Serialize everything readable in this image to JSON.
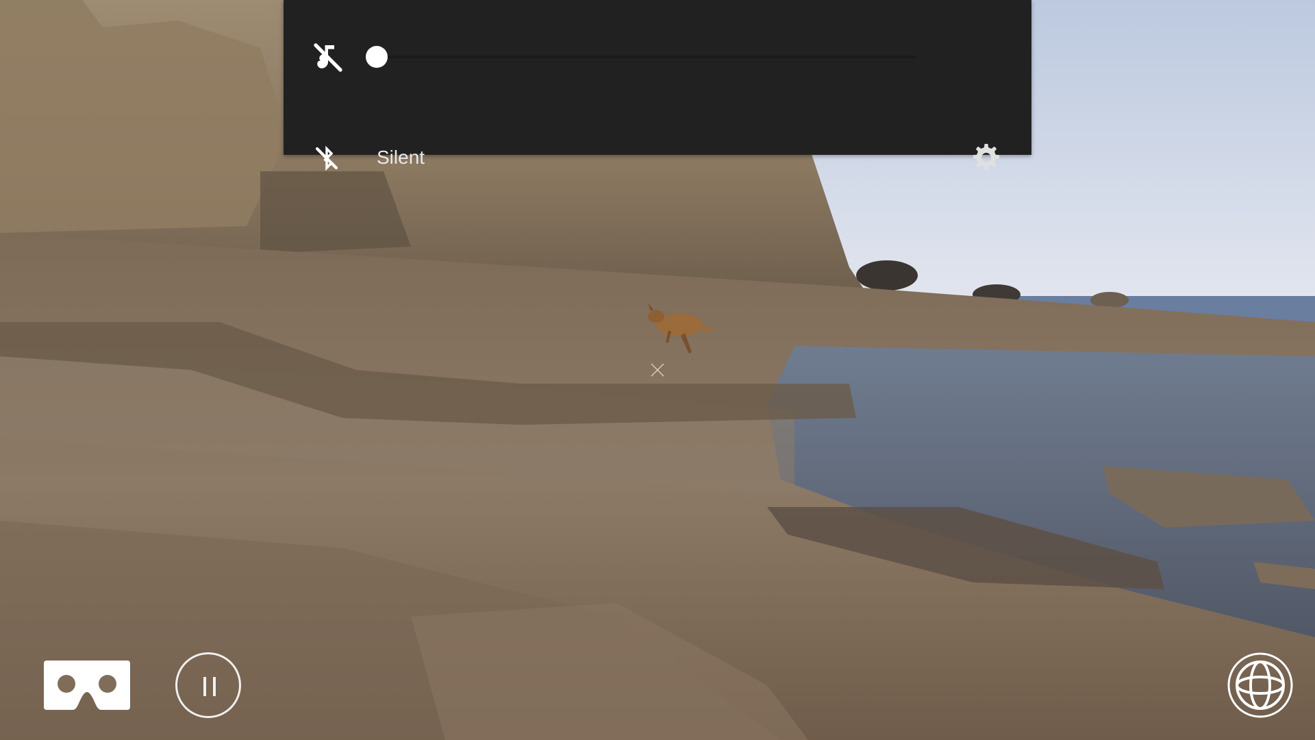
{
  "player": {
    "mode": "360 video",
    "state": "playing"
  },
  "volume_panel": {
    "slider_value": 0,
    "row1_icon": "volume-muted-icon",
    "row2_icon": "bluetooth-off-icon",
    "row2_label": "Silent",
    "row2_right_icon": "gear-icon",
    "colors": {
      "panel_bg": "#212121",
      "thumb": "#ffffff",
      "track": "#1a1a1a"
    }
  },
  "controls": {
    "cardboard_icon": "cardboard-vr-icon",
    "pause_icon": "pause-icon",
    "view_mode_icon": "globe-360-icon"
  }
}
